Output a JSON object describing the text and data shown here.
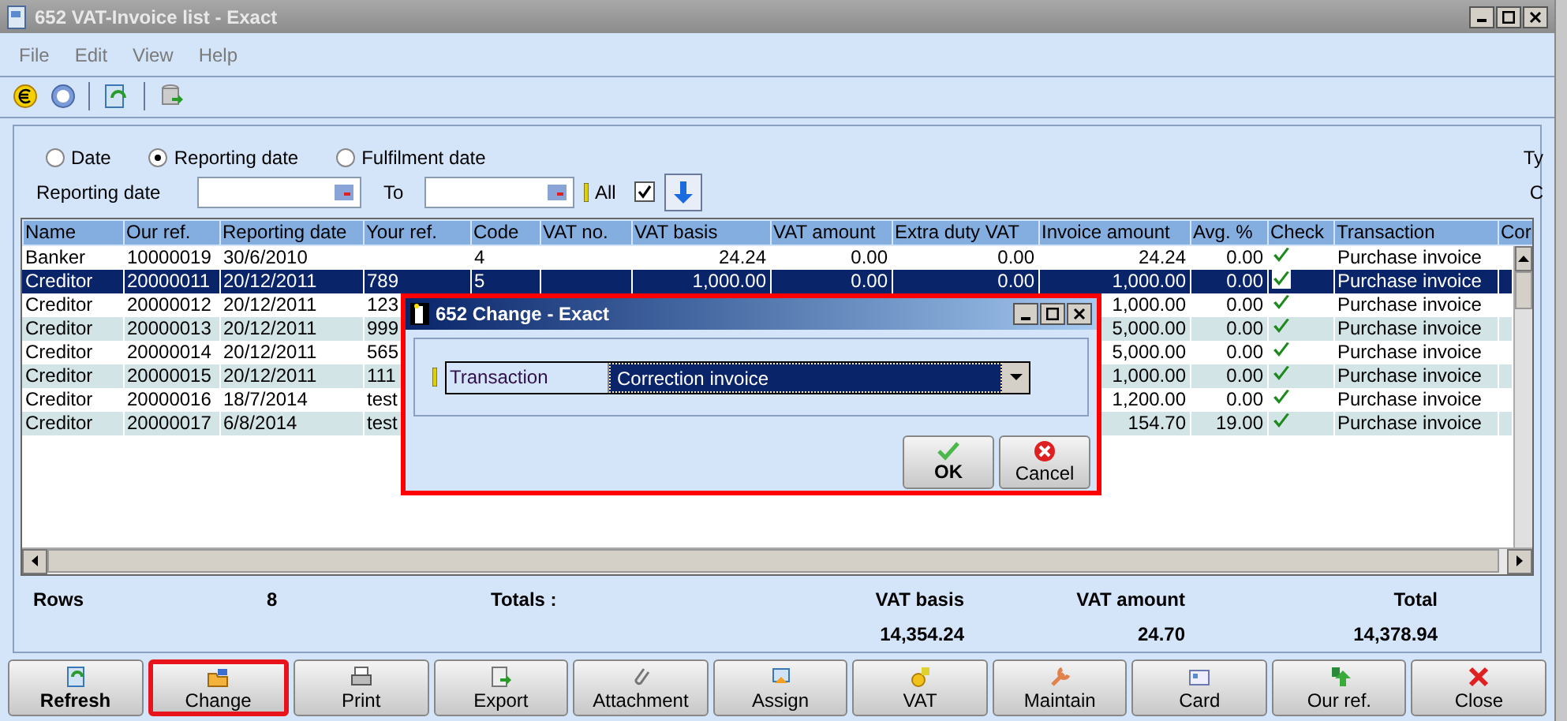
{
  "window": {
    "title": "652 VAT-Invoice list - Exact"
  },
  "menu": [
    "File",
    "Edit",
    "View",
    "Help"
  ],
  "filter": {
    "date_types": [
      {
        "label": "Date",
        "selected": false
      },
      {
        "label": "Reporting date",
        "selected": true
      },
      {
        "label": "Fulfilment date",
        "selected": false
      }
    ],
    "from_label": "Reporting date",
    "to_label": "To",
    "all_label": "All",
    "all_checked": true,
    "right_labels": [
      "Ty",
      "C"
    ]
  },
  "table": {
    "columns": [
      "Name",
      "Our ref.",
      "Reporting date",
      "Your ref.",
      "Code",
      "VAT no.",
      "VAT basis",
      "VAT amount",
      "Extra duty VAT",
      "Invoice amount",
      "Avg. %",
      "Check",
      "Transaction",
      "Cor"
    ],
    "rows": [
      {
        "selected": false,
        "name": "Banker",
        "our_ref": "10000019",
        "reporting_date": "30/6/2010",
        "code": "4",
        "vat_basis": "24.24",
        "vat_amount": "0.00",
        "extra_duty": "0.00",
        "invoice_amount": "24.24",
        "avg": "0.00",
        "checked": true,
        "transaction": "Purchase invoice"
      },
      {
        "selected": true,
        "name": "Creditor",
        "our_ref": "20000011",
        "reporting_date": "20/12/2011",
        "your_ref": "789",
        "code": "5",
        "vat_basis": "1,000.00",
        "vat_amount": "0.00",
        "extra_duty": "0.00",
        "invoice_amount": "1,000.00",
        "avg": "0.00",
        "checked": true,
        "transaction": "Purchase invoice"
      },
      {
        "selected": false,
        "name": "Creditor",
        "our_ref": "20000012",
        "reporting_date": "20/12/2011",
        "your_ref": "123",
        "invoice_amount": "1,000.00",
        "avg": "0.00",
        "checked": true,
        "transaction": "Purchase invoice"
      },
      {
        "selected": false,
        "name": "Creditor",
        "our_ref": "20000013",
        "reporting_date": "20/12/2011",
        "your_ref": "999",
        "invoice_amount": "5,000.00",
        "avg": "0.00",
        "checked": true,
        "transaction": "Purchase invoice"
      },
      {
        "selected": false,
        "name": "Creditor",
        "our_ref": "20000014",
        "reporting_date": "20/12/2011",
        "your_ref": "565",
        "invoice_amount": "5,000.00",
        "avg": "0.00",
        "checked": true,
        "transaction": "Purchase invoice"
      },
      {
        "selected": false,
        "name": "Creditor",
        "our_ref": "20000015",
        "reporting_date": "20/12/2011",
        "your_ref": "111",
        "invoice_amount": "1,000.00",
        "avg": "0.00",
        "checked": true,
        "transaction": "Purchase invoice"
      },
      {
        "selected": false,
        "name": "Creditor",
        "our_ref": "20000016",
        "reporting_date": "18/7/2014",
        "your_ref": "test",
        "invoice_amount": "1,200.00",
        "avg": "0.00",
        "checked": true,
        "transaction": "Purchase invoice"
      },
      {
        "selected": false,
        "name": "Creditor",
        "our_ref": "20000017",
        "reporting_date": "6/8/2014",
        "your_ref": "test",
        "invoice_amount": "154.70",
        "avg": "19.00",
        "checked": true,
        "transaction": "Purchase invoice"
      }
    ]
  },
  "summary": {
    "rows_label": "Rows",
    "rows_count": "8",
    "totals_label": "Totals :",
    "columns": [
      {
        "label": "VAT basis",
        "value": "14,354.24"
      },
      {
        "label": "VAT amount",
        "value": "24.70"
      },
      {
        "label": "Total",
        "value": "14,378.94"
      }
    ]
  },
  "buttons": [
    {
      "label": "Refresh",
      "default": true,
      "highlighted": false
    },
    {
      "label": "Change",
      "default": false,
      "highlighted": true
    },
    {
      "label": "Print",
      "default": false,
      "highlighted": false
    },
    {
      "label": "Export",
      "default": false,
      "highlighted": false
    },
    {
      "label": "Attachment",
      "default": false,
      "highlighted": false
    },
    {
      "label": "Assign",
      "default": false,
      "highlighted": false
    },
    {
      "label": "VAT",
      "default": false,
      "highlighted": false
    },
    {
      "label": "Maintain",
      "default": false,
      "highlighted": false
    },
    {
      "label": "Card",
      "default": false,
      "highlighted": false
    },
    {
      "label": "Our ref.",
      "default": false,
      "highlighted": false
    },
    {
      "label": "Close",
      "default": false,
      "highlighted": false
    }
  ],
  "dialog": {
    "title": "652 Change - Exact",
    "highlighted": true,
    "field_label": "Transaction",
    "field_value": "Correction invoice",
    "buttons": [
      {
        "label": "OK",
        "default": true
      },
      {
        "label": "Cancel",
        "default": false
      }
    ]
  }
}
